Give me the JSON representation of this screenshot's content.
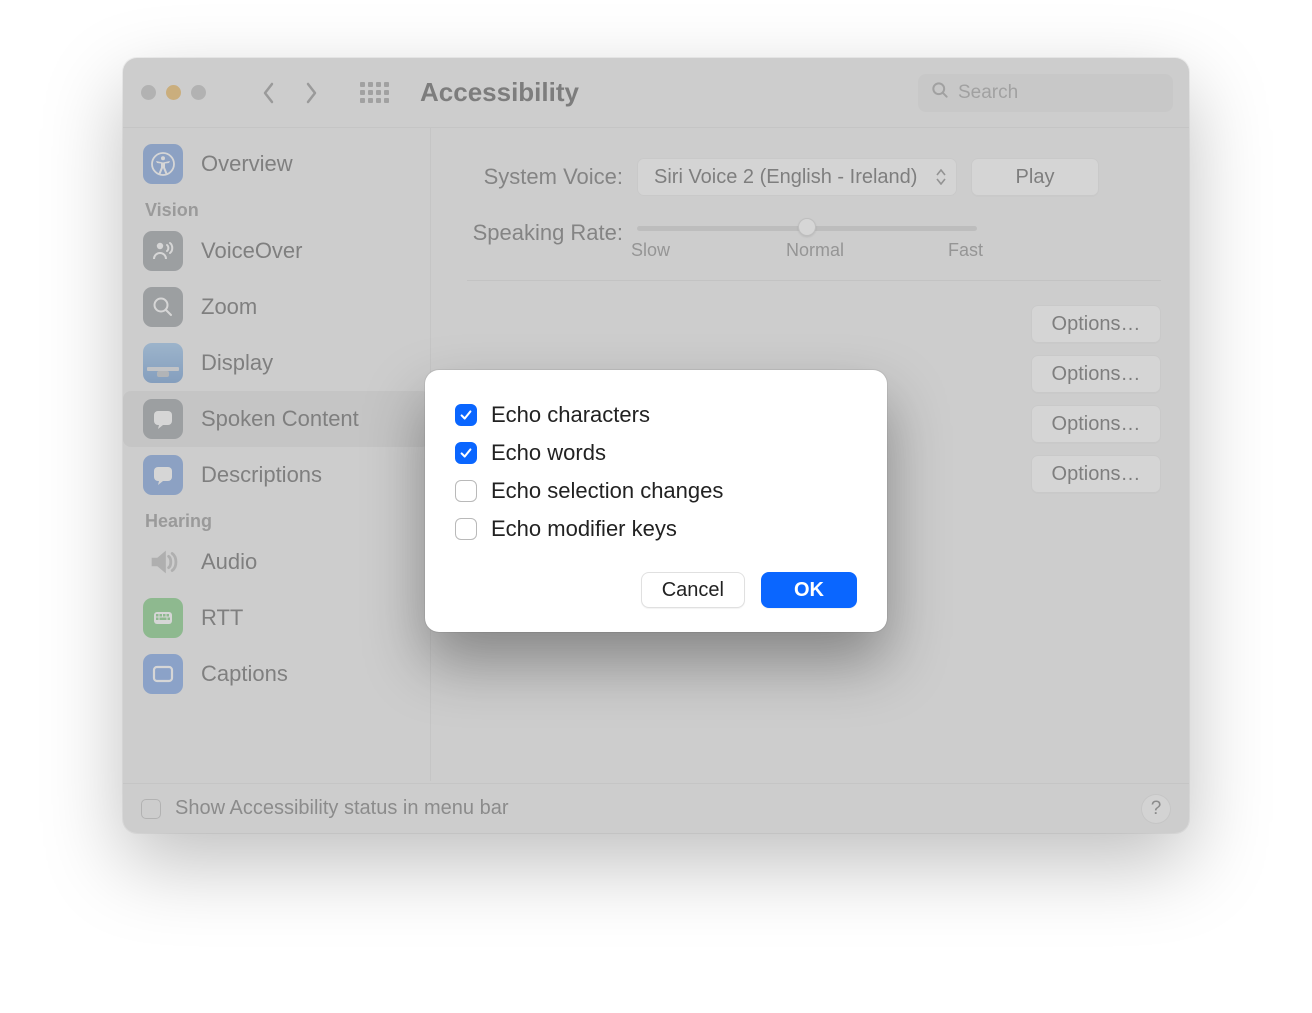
{
  "window": {
    "title": "Accessibility",
    "search_placeholder": "Search"
  },
  "sidebar": {
    "items": [
      {
        "label": "Overview"
      },
      {
        "label": "VoiceOver"
      },
      {
        "label": "Zoom"
      },
      {
        "label": "Display"
      },
      {
        "label": "Spoken Content"
      },
      {
        "label": "Descriptions"
      },
      {
        "label": "Audio"
      },
      {
        "label": "RTT"
      },
      {
        "label": "Captions"
      }
    ],
    "sections": {
      "vision": "Vision",
      "hearing": "Hearing"
    }
  },
  "main": {
    "system_voice_label": "System Voice:",
    "system_voice_value": "Siri Voice 2 (English - Ireland)",
    "play_label": "Play",
    "speaking_rate_label": "Speaking Rate:",
    "rate_labels": {
      "slow": "Slow",
      "normal": "Normal",
      "fast": "Fast"
    },
    "options_label": "Options…"
  },
  "footer": {
    "status_label": "Show Accessibility status in menu bar",
    "help": "?"
  },
  "modal": {
    "options": [
      {
        "label": "Echo characters",
        "checked": true
      },
      {
        "label": "Echo words",
        "checked": true
      },
      {
        "label": "Echo selection changes",
        "checked": false
      },
      {
        "label": "Echo modifier keys",
        "checked": false
      }
    ],
    "cancel": "Cancel",
    "ok": "OK"
  }
}
